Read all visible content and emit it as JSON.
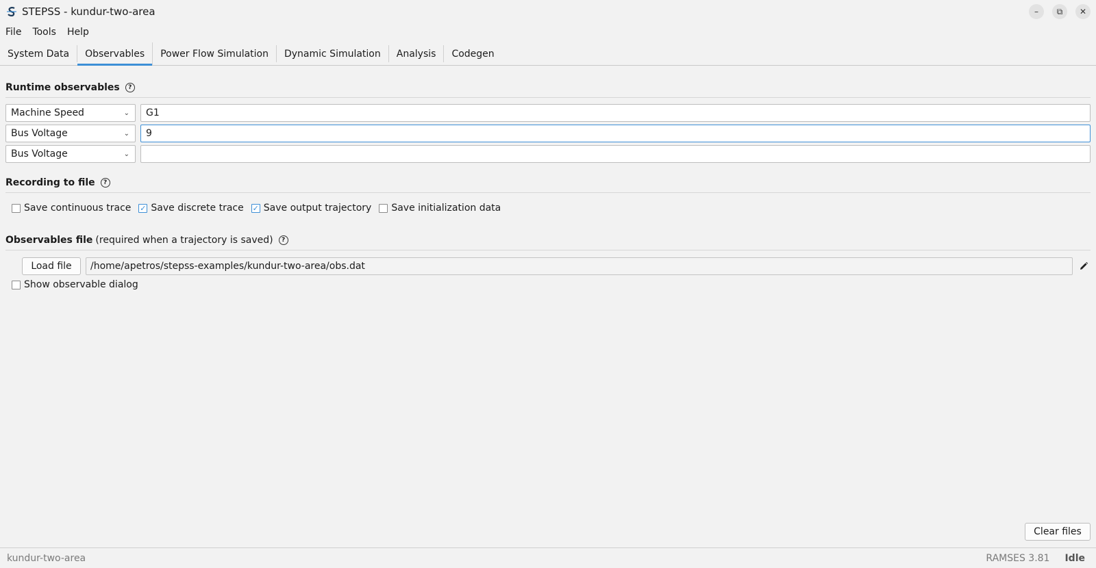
{
  "window": {
    "title": "STEPSS - kundur-two-area",
    "icon": "stepss-logo-icon",
    "controls": [
      "minimize-icon",
      "restore-icon",
      "close-icon"
    ]
  },
  "menu": [
    "File",
    "Tools",
    "Help"
  ],
  "tabs": [
    {
      "label": "System Data",
      "active": false
    },
    {
      "label": "Observables",
      "active": true
    },
    {
      "label": "Power Flow Simulation",
      "active": false
    },
    {
      "label": "Dynamic Simulation",
      "active": false
    },
    {
      "label": "Analysis",
      "active": false
    },
    {
      "label": "Codegen",
      "active": false
    }
  ],
  "runtime": {
    "title": "Runtime observables",
    "rows": [
      {
        "type": "Machine Speed",
        "value": "G1",
        "focused": false
      },
      {
        "type": "Bus Voltage",
        "value": "9",
        "focused": true
      },
      {
        "type": "Bus Voltage",
        "value": "",
        "focused": false
      }
    ]
  },
  "recording": {
    "title": "Recording to file",
    "options": [
      {
        "label": "Save continuous trace",
        "checked": false
      },
      {
        "label": "Save discrete trace",
        "checked": true
      },
      {
        "label": "Save output trajectory",
        "checked": true
      },
      {
        "label": "Save initialization data",
        "checked": false
      }
    ]
  },
  "obsfile": {
    "title": "Observables file",
    "subtitle": "(required when a trajectory is saved)",
    "load_label": "Load file",
    "path": "/home/apetros/stepss-examples/kundur-two-area/obs.dat",
    "show_dialog_label": "Show observable dialog",
    "show_dialog_checked": false
  },
  "clear_label": "Clear files",
  "status": {
    "left": "kundur-two-area",
    "version": "RAMSES 3.81",
    "state": "Idle"
  },
  "colors": {
    "accent": "#3d8fd6",
    "background": "#f2f2f2"
  }
}
